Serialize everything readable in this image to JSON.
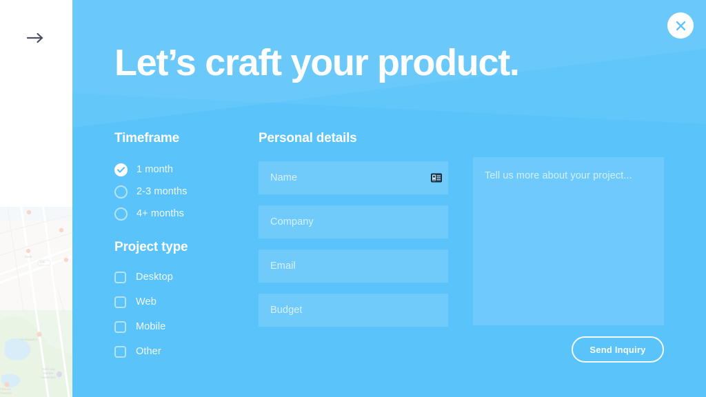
{
  "sidebar": {
    "back_arrow_icon": "arrow-right-icon",
    "map": {
      "labels": [
        "Vondelpark3",
        "Hotel City Garden Amsterdam",
        "t Blauwe Theehuis",
        "Zoek",
        "s106"
      ]
    }
  },
  "panel": {
    "background_color": "#59c3fa",
    "close_label": "✕",
    "title": "Let’s craft your product.",
    "timeframe": {
      "heading": "Timeframe",
      "options": [
        {
          "label": "1 month",
          "selected": true
        },
        {
          "label": "2-3 months",
          "selected": false
        },
        {
          "label": "4+ months",
          "selected": false
        }
      ]
    },
    "project_type": {
      "heading": "Project type",
      "options": [
        {
          "label": "Desktop",
          "checked": false
        },
        {
          "label": "Web",
          "checked": false
        },
        {
          "label": "Mobile",
          "checked": false
        },
        {
          "label": "Other",
          "checked": false
        }
      ]
    },
    "personal_details": {
      "heading": "Personal details",
      "fields": [
        {
          "name": "name",
          "placeholder": "Name",
          "value": "",
          "autofill_icon": "contact-card-icon"
        },
        {
          "name": "company",
          "placeholder": "Company",
          "value": ""
        },
        {
          "name": "email",
          "placeholder": "Email",
          "value": ""
        },
        {
          "name": "budget",
          "placeholder": "Budget",
          "value": ""
        }
      ]
    },
    "message": {
      "placeholder": "Tell us more about your project...",
      "value": ""
    },
    "submit": {
      "label": "Send Inquiry"
    }
  }
}
